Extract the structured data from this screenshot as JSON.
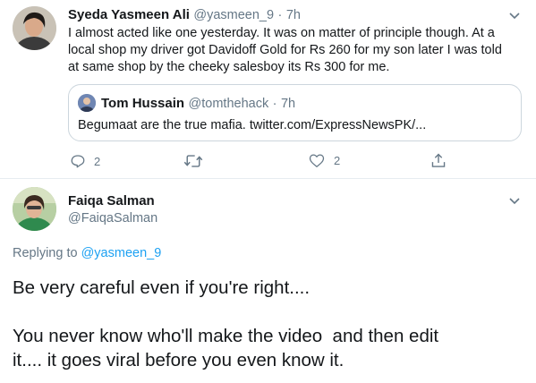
{
  "tweet1": {
    "author_name": "Syeda Yasmeen Ali",
    "handle": "@yasmeen_9",
    "separator": "·",
    "time": "7h",
    "lines": [
      "I almost acted like one yesterday. It was on matter of principle though. At a",
      "local shop my driver got Davidoff Gold for Rs 260 for my son later I was told",
      "at same shop by the cheeky salesboy its Rs 300 for me."
    ],
    "quote": {
      "author_name": "Tom Hussain",
      "handle": "@tomthehack",
      "separator": "·",
      "time": "7h",
      "text": "Begumaat are the true mafia. twitter.com/ExpressNewsPK/..."
    },
    "actions": {
      "reply_count": "2",
      "retweet_count": "",
      "like_count": "2"
    }
  },
  "tweet2": {
    "author_name": "Faiqa Salman",
    "handle": "@FaiqaSalman",
    "replying_prefix": "Replying to",
    "replying_handle": "@yasmeen_9",
    "paragraph1": "Be very careful even if you're right....",
    "paragraph2_line1": "You never know who'll make the video  and then edit",
    "paragraph2_line2": "it.... it goes viral before you even know it."
  },
  "colors": {
    "link": "#1da1f2",
    "muted": "#657786",
    "border": "#ccd6dd"
  }
}
